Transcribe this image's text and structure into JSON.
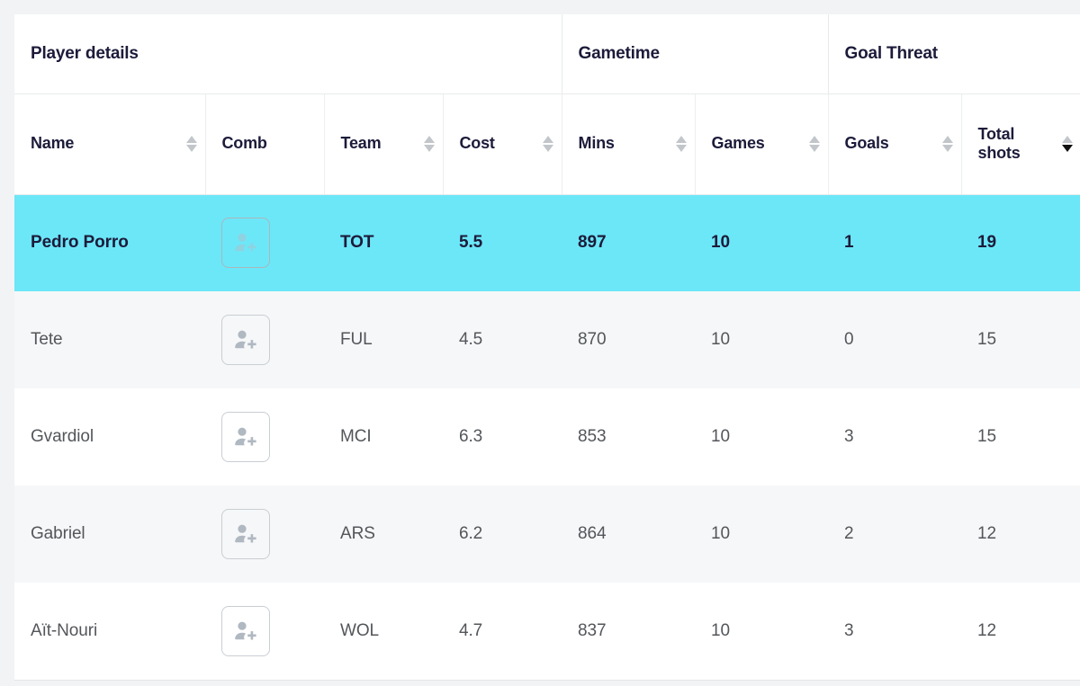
{
  "table": {
    "group_headers": [
      {
        "label": "Player details",
        "span": 4
      },
      {
        "label": "Gametime",
        "span": 2
      },
      {
        "label": "Goal Threat",
        "span": 2
      }
    ],
    "columns": [
      {
        "key": "name",
        "label": "Name",
        "sortable": true,
        "sort": "none"
      },
      {
        "key": "comb",
        "label": "Comb",
        "sortable": false,
        "sort": "none"
      },
      {
        "key": "team",
        "label": "Team",
        "sortable": true,
        "sort": "none"
      },
      {
        "key": "cost",
        "label": "Cost",
        "sortable": true,
        "sort": "none"
      },
      {
        "key": "mins",
        "label": "Mins",
        "sortable": true,
        "sort": "none"
      },
      {
        "key": "games",
        "label": "Games",
        "sortable": true,
        "sort": "none"
      },
      {
        "key": "goals",
        "label": "Goals",
        "sortable": true,
        "sort": "none"
      },
      {
        "key": "total_shots",
        "label": "Total\nshots",
        "sortable": true,
        "sort": "desc"
      }
    ],
    "rows": [
      {
        "name": "Pedro Porro",
        "comb_icon": "add-person-icon",
        "team": "TOT",
        "cost": "5.5",
        "mins": "897",
        "games": "10",
        "goals": "1",
        "total_shots": "19",
        "selected": true
      },
      {
        "name": "Tete",
        "comb_icon": "add-person-icon",
        "team": "FUL",
        "cost": "4.5",
        "mins": "870",
        "games": "10",
        "goals": "0",
        "total_shots": "15",
        "selected": false
      },
      {
        "name": "Gvardiol",
        "comb_icon": "add-person-icon",
        "team": "MCI",
        "cost": "6.3",
        "mins": "853",
        "games": "10",
        "goals": "3",
        "total_shots": "15",
        "selected": false
      },
      {
        "name": "Gabriel",
        "comb_icon": "add-person-icon",
        "team": "ARS",
        "cost": "6.2",
        "mins": "864",
        "games": "10",
        "goals": "2",
        "total_shots": "12",
        "selected": false
      },
      {
        "name": "Aït-Nouri",
        "comb_icon": "add-person-icon",
        "team": "WOL",
        "cost": "4.7",
        "mins": "837",
        "games": "10",
        "goals": "3",
        "total_shots": "12",
        "selected": false
      }
    ]
  },
  "colors": {
    "selected_row": "#6ce7f8",
    "header_text": "#1c1b3a",
    "body_text": "#53565a",
    "alt_row": "#f6f7f8",
    "border": "#e8eaec",
    "page_bg": "#f2f3f5",
    "sort_inactive": "#c2c6cb",
    "sort_active": "#111111",
    "icon_gray": "#b0b8c1"
  }
}
